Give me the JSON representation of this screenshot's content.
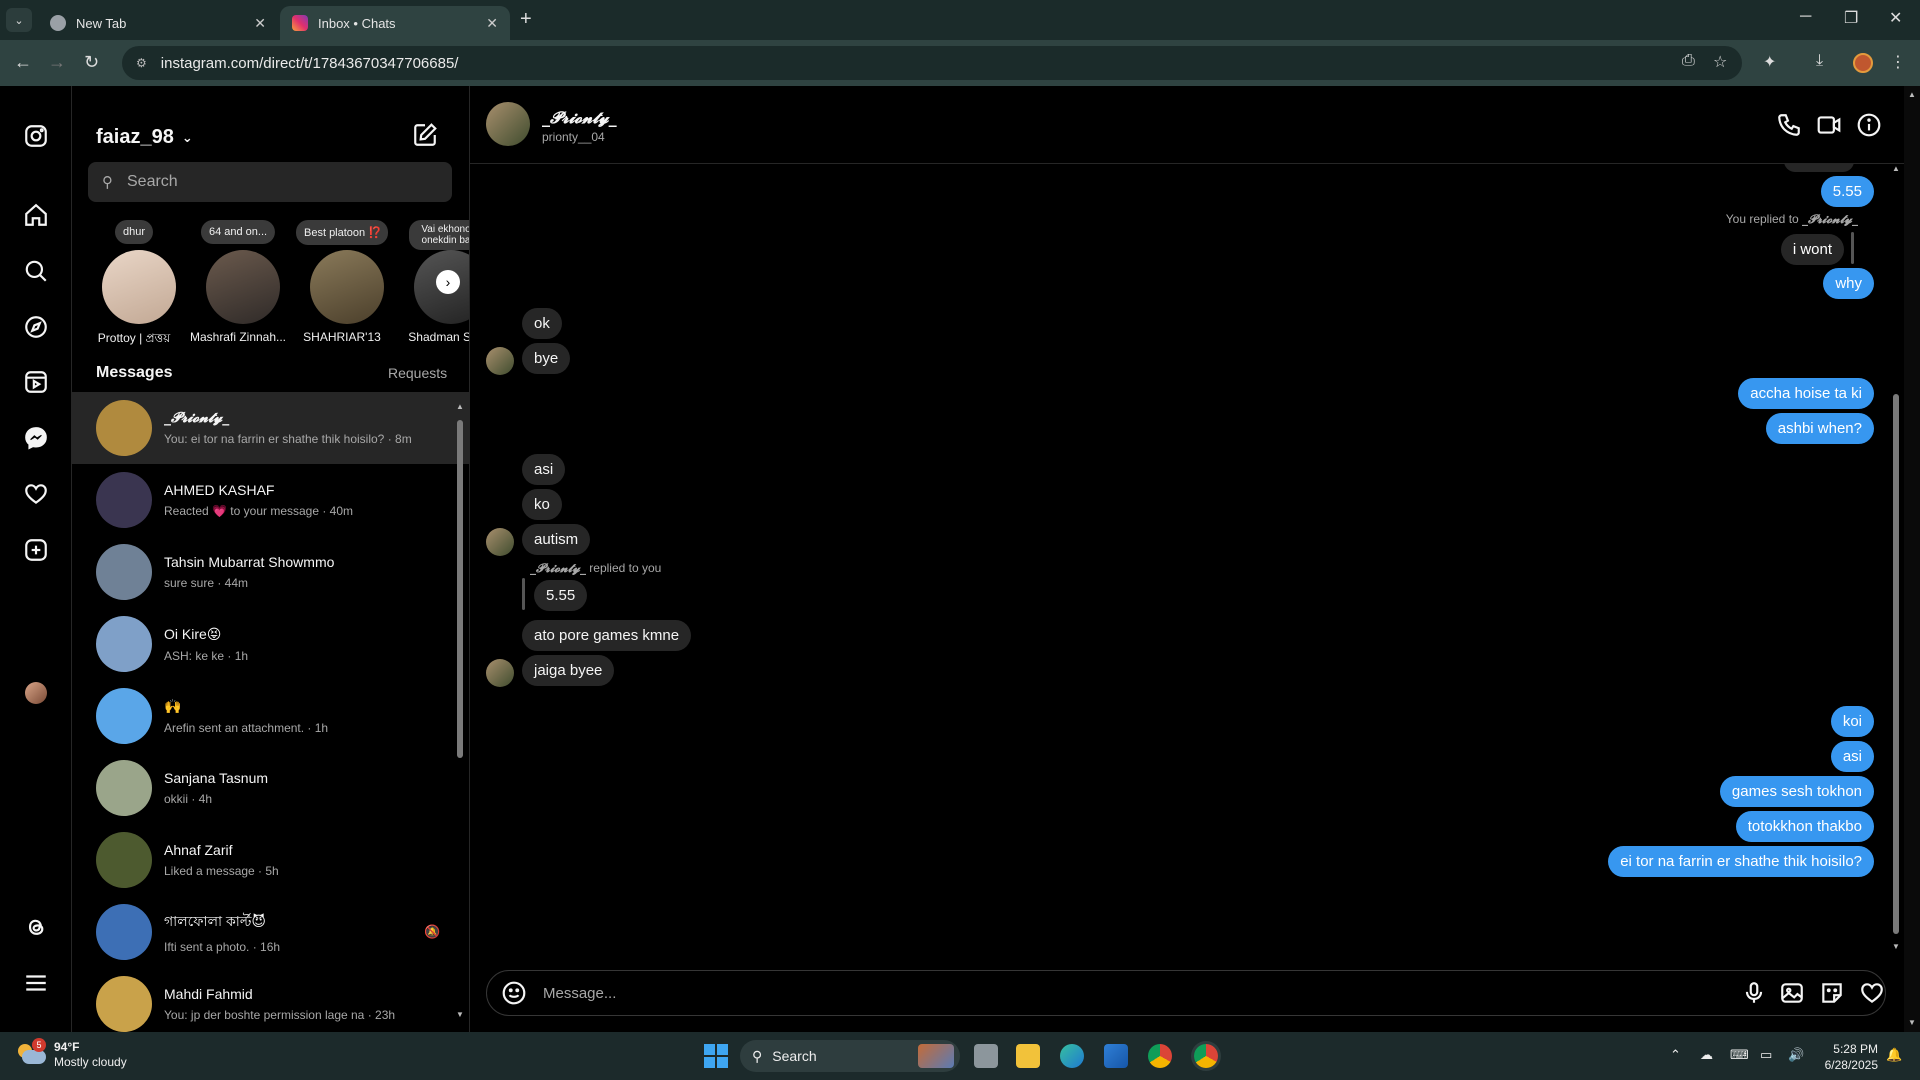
{
  "browser": {
    "tabs": [
      {
        "label": "New Tab"
      },
      {
        "label": "Inbox • Chats"
      }
    ],
    "url": "instagram.com/direct/t/17843670347706685/"
  },
  "sidebar_list": {
    "account": "faiaz_98",
    "search_placeholder": "Search",
    "stories": [
      {
        "note": "dhur",
        "name": "Prottoy | প্রত্তয়"
      },
      {
        "note": "64 and on...",
        "name": "Mashrafi Zinnah..."
      },
      {
        "note": "Best platoon ⁉️",
        "name": "SHAHRIAR'13"
      },
      {
        "note": "Vai ekhono onekdin ba",
        "name": "Shadman Sak"
      }
    ],
    "messages_label": "Messages",
    "requests_label": "Requests",
    "conversations": [
      {
        "name": "_𝓟𝓻𝓲𝓸𝓷𝓽𝔂_",
        "preview": "You: ei tor na farrin er shathe thik hoisilo? · 8m",
        "active": true,
        "color": "#b08a3e"
      },
      {
        "name": "AHMED KASHAF",
        "preview": "Reacted 💗 to your message · 40m",
        "color": "#3a3550"
      },
      {
        "name": "Tahsin Mubarrat Showmmo",
        "preview": "sure sure · 44m",
        "color": "#6f8196"
      },
      {
        "name": "Oi Kire😝",
        "preview": "ASH: ke ke · 1h",
        "color": "#7fa0c8"
      },
      {
        "name": "🙌",
        "preview": "Arefin sent an attachment. · 1h",
        "color": "#5aa6e8"
      },
      {
        "name": "Sanjana Tasnum",
        "preview": "okkii · 4h",
        "color": "#9aa58a"
      },
      {
        "name": "Ahnaf Zarif",
        "preview": "Liked a message · 5h",
        "color": "#4d5a2f"
      },
      {
        "name": "গালফোলা কার্ল্ট😈",
        "preview": "Ifti sent a photo. · 16h",
        "color": "#3d6fb5",
        "muted": true
      },
      {
        "name": "Mahdi Fahmid",
        "preview": "You: jp der boshte permission lage na · 23h",
        "color": "#c9a24a"
      }
    ]
  },
  "chat": {
    "name": "_𝓟𝓻𝓲𝓸𝓷𝓽𝔂_",
    "username": "prionty__04",
    "composer_placeholder": "Message...",
    "messages": {
      "m1": "5.55",
      "replied_note_prefix": "You replied to",
      "replied_note_name": "_𝓟𝓻𝓲𝓸𝓷𝓽𝔂_",
      "m2": "i wont",
      "m3": "why",
      "m4": "ok",
      "m5": "bye",
      "m6": "accha hoise ta ki",
      "m7": "ashbi when?",
      "m8": "asi",
      "m9": "ko",
      "m10": "autism",
      "reply2_name": "_𝓟𝓻𝓲𝓸𝓷𝓽𝔂_",
      "reply2_suffix": "replied to you",
      "m11": "5.55",
      "m12": "ato pore games kmne",
      "m13": "jaiga byee",
      "m14": "koi",
      "m15": "asi",
      "m16": "games sesh tokhon",
      "m17": "totokkhon thakbo",
      "m18": "ei tor na farrin er shathe thik hoisilo?"
    }
  },
  "taskbar": {
    "weather_badge": "5",
    "temp": "94°F",
    "condition": "Mostly cloudy",
    "search_label": "Search",
    "time": "5:28 PM",
    "date": "6/28/2025"
  }
}
